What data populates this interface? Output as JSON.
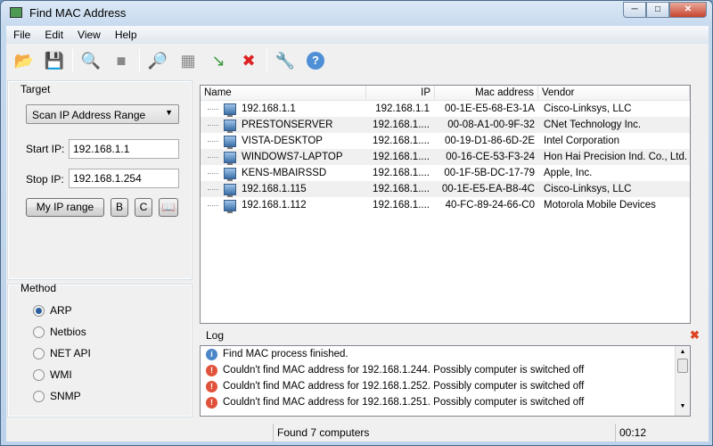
{
  "window": {
    "title": "Find MAC Address"
  },
  "menu": [
    "File",
    "Edit",
    "View",
    "Help"
  ],
  "toolbar": [
    "open-icon",
    "save-icon",
    "start-scan-icon",
    "stop-scan-icon",
    "find-icon",
    "columns-icon",
    "export-icon",
    "clear-icon",
    "options-icon",
    "help-icon"
  ],
  "target": {
    "label": "Target",
    "mode": "Scan IP Address Range",
    "start_label": "Start IP:",
    "start_value": "192.168.1.1",
    "stop_label": "Stop IP:",
    "stop_value": "192.168.1.254",
    "my_ip_button": "My IP range",
    "b_button": "B",
    "c_button": "C"
  },
  "method": {
    "label": "Method",
    "options": [
      "ARP",
      "Netbios",
      "NET API",
      "WMI",
      "SNMP"
    ],
    "selected": "ARP"
  },
  "list": {
    "columns": [
      "Name",
      "IP",
      "Mac address",
      "Vendor"
    ],
    "rows": [
      {
        "name": "192.168.1.1",
        "ip": "192.168.1.1",
        "mac": "00-1E-E5-68-E3-1A",
        "vendor": "Cisco-Linksys, LLC"
      },
      {
        "name": "PRESTONSERVER",
        "ip": "192.168.1....",
        "mac": "00-08-A1-00-9F-32",
        "vendor": "CNet Technology Inc."
      },
      {
        "name": "VISTA-DESKTOP",
        "ip": "192.168.1....",
        "mac": "00-19-D1-86-6D-2E",
        "vendor": "Intel Corporation"
      },
      {
        "name": "WINDOWS7-LAPTOP",
        "ip": "192.168.1....",
        "mac": "00-16-CE-53-F3-24",
        "vendor": "Hon Hai Precision Ind. Co., Ltd."
      },
      {
        "name": "KENS-MBAIRSSD",
        "ip": "192.168.1....",
        "mac": "00-1F-5B-DC-17-79",
        "vendor": "Apple, Inc."
      },
      {
        "name": "192.168.1.115",
        "ip": "192.168.1....",
        "mac": "00-1E-E5-EA-B8-4C",
        "vendor": "Cisco-Linksys, LLC"
      },
      {
        "name": "192.168.1.112",
        "ip": "192.168.1....",
        "mac": "40-FC-89-24-66-C0",
        "vendor": "Motorola Mobile Devices"
      }
    ]
  },
  "log": {
    "label": "Log",
    "entries": [
      {
        "type": "info",
        "text": "Find MAC process finished."
      },
      {
        "type": "error",
        "text": "Couldn't find MAC address for 192.168.1.244. Possibly computer is switched off"
      },
      {
        "type": "error",
        "text": "Couldn't find MAC address for 192.168.1.252. Possibly computer is switched off"
      },
      {
        "type": "error",
        "text": "Couldn't find MAC address for 192.168.1.251. Possibly computer is switched off"
      }
    ]
  },
  "status": {
    "found": "Found 7 computers",
    "time": "00:12"
  }
}
